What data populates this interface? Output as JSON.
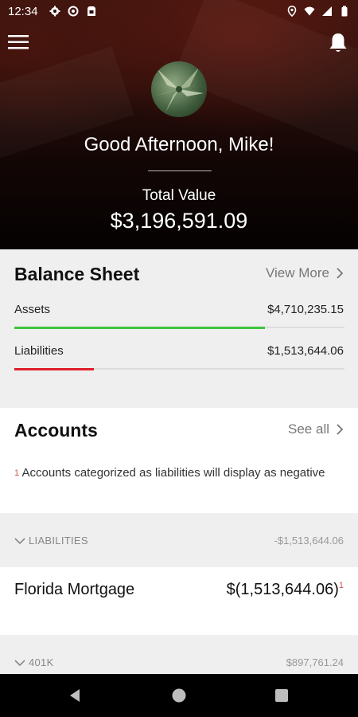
{
  "status_bar": {
    "time": "12:34"
  },
  "header": {
    "greeting": "Good Afternoon, Mike!",
    "total_label": "Total Value",
    "total_value": "$3,196,591.09"
  },
  "balance_sheet": {
    "title": "Balance Sheet",
    "view_more_label": "View More",
    "rows": [
      {
        "label": "Assets",
        "value": "$4,710,235.15",
        "bar_fraction": 0.76,
        "bar_color": "#3ec43e"
      },
      {
        "label": "Liabilities",
        "value": "$1,513,644.06",
        "bar_fraction": 0.24,
        "bar_color": "#e0202a"
      }
    ]
  },
  "accounts": {
    "title": "Accounts",
    "see_all_label": "See all",
    "footnote_marker": "1",
    "footnote_text": "Accounts categorized as liabilities will display as negative",
    "sections": [
      {
        "name": "LIABILITIES",
        "total": "-$1,513,644.06",
        "items": [
          {
            "name": "Florida Mortgage",
            "value": "$(1,513,644.06)",
            "marker": "1"
          }
        ]
      },
      {
        "name": "401K",
        "total": "$897,761.24"
      }
    ]
  },
  "colors": {
    "accent_green": "#3ec43e",
    "accent_red": "#e0202a",
    "footnote_red": "#d9534f"
  },
  "icons": [
    "settings-icon",
    "sync-icon",
    "sim-card-icon",
    "location-icon",
    "wifi-icon",
    "signal-icon",
    "battery-icon",
    "menu-icon",
    "bell-icon",
    "chevron-right-icon",
    "chevron-down-icon",
    "back-icon",
    "home-icon",
    "recents-icon"
  ]
}
